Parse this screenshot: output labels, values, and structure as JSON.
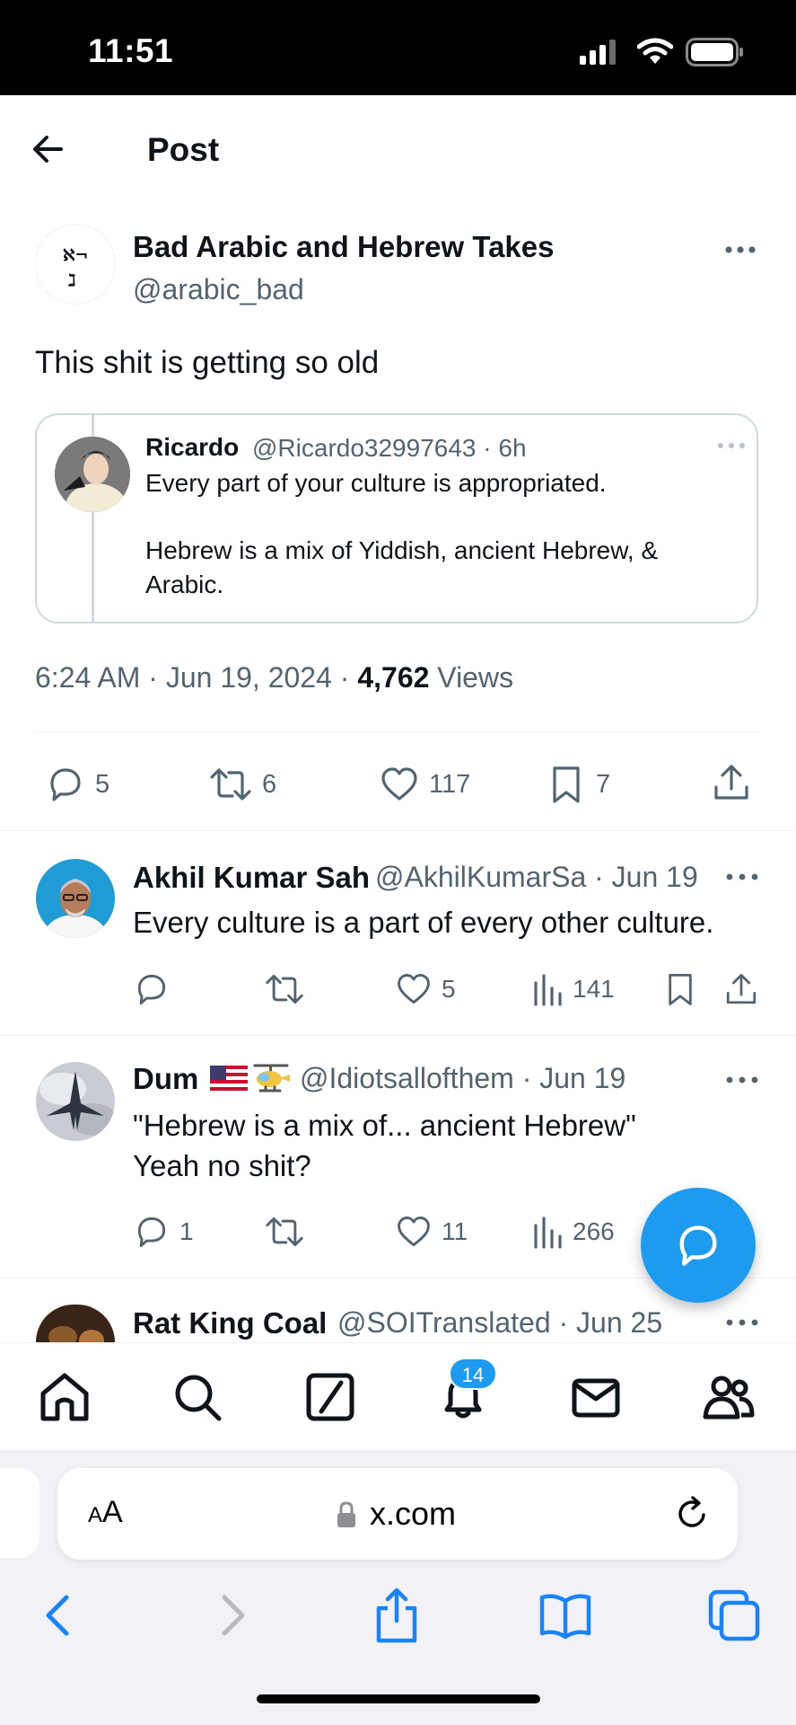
{
  "status_bar": {
    "time": "11:51"
  },
  "header": {
    "title": "Post"
  },
  "post": {
    "author_name": "Bad Arabic and Hebrew Takes",
    "author_handle": "@arabic_bad",
    "avatar_glyphs": {
      "top": "ℵ¬",
      "bottom": "ℷ"
    },
    "text": "This shit is getting so old",
    "quote": {
      "name": "Ricardo",
      "handle_time": "@Ricardo32997643 · 6h",
      "line1": "Every part of your culture is appropriated.",
      "line2": "Hebrew is a mix of Yiddish, ancient Hebrew, & Arabic."
    },
    "meta_time": "6:24 AM · Jun 19, 2024 · ",
    "views_count": "4,762",
    "views_label": " Views",
    "stats": {
      "replies": "5",
      "reposts": "6",
      "likes": "117",
      "bookmarks": "7"
    }
  },
  "replies": [
    {
      "name": "Akhil Kumar Sah",
      "handle_time": "@AkhilKumarSa · Jun 19",
      "text": "Every culture is a part of every other culture.",
      "replies": "",
      "reposts": "",
      "likes": "5",
      "views": "141"
    },
    {
      "name": "Dum",
      "handle_time": "@Idiotsallofthem · Jun 19",
      "text_line1": "\"Hebrew is a mix of... ancient Hebrew\"",
      "text_line2": "Yeah no shit?",
      "replies": "1",
      "reposts": "",
      "likes": "11",
      "views": "266"
    },
    {
      "name": "Rat King Coal",
      "handle_time": "@SOITranslated · Jun 25"
    }
  ],
  "tabbar": {
    "notification_count": "14"
  },
  "browser": {
    "aa_label_small": "A",
    "aa_label_large": "A",
    "url": "x.com"
  },
  "colors": {
    "accent": "#1d9bf0",
    "secondary_text": "#536471",
    "divider": "#eff3f4"
  }
}
